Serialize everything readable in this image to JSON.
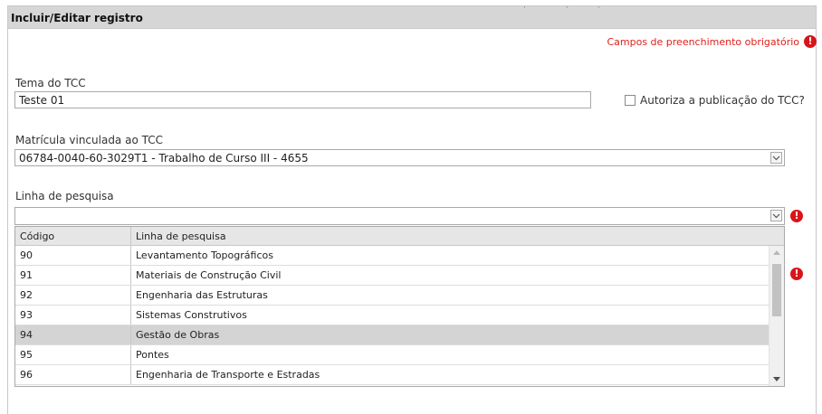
{
  "panel": {
    "title": "Incluir/Editar registro"
  },
  "required_note": {
    "text": "Campos de preenchimento obrigatório",
    "icon": "exclamation-icon",
    "color": "#e0201b"
  },
  "form": {
    "tema": {
      "label": "Tema do TCC",
      "value": "Teste 01"
    },
    "autoriza": {
      "label": "Autoriza a publicação do TCC?",
      "checked": false
    },
    "matricula": {
      "label": "Matrícula vinculada ao TCC",
      "value": "06784-0040-60-3029T1 - Trabalho de Curso III - 4655"
    },
    "linha": {
      "label": "Linha de pesquisa",
      "value": ""
    }
  },
  "dropdown": {
    "headers": [
      "Código",
      "Linha de pesquisa"
    ],
    "rows": [
      {
        "code": "90",
        "name": "Levantamento Topográficos"
      },
      {
        "code": "91",
        "name": "Materiais de Construção Civil"
      },
      {
        "code": "92",
        "name": "Engenharia das Estruturas"
      },
      {
        "code": "93",
        "name": "Sistemas Construtivos"
      },
      {
        "code": "94",
        "name": "Gestão de Obras"
      },
      {
        "code": "95",
        "name": "Pontes"
      },
      {
        "code": "96",
        "name": "Engenharia de Transporte e Estradas"
      }
    ],
    "selected_code": "94"
  },
  "colors": {
    "header_bg": "#d6d6d6",
    "selected_row_bg": "#d4d4d4",
    "error_icon": "#d9141b"
  }
}
